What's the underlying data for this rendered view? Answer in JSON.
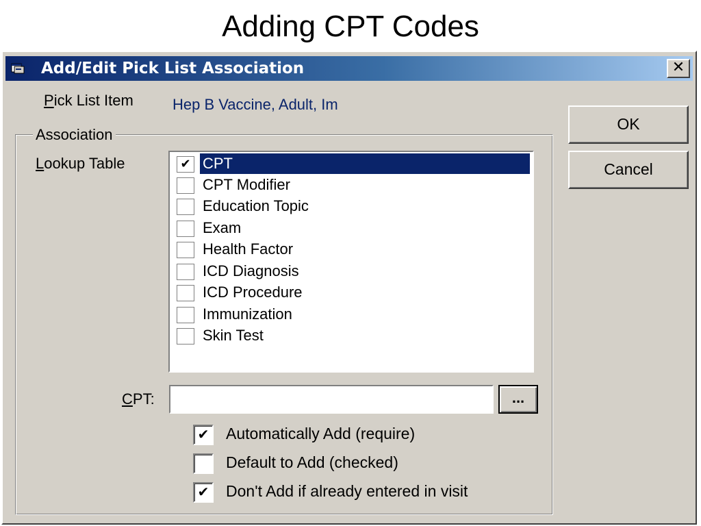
{
  "slide": {
    "title": "Adding CPT Codes"
  },
  "window": {
    "title": "Add/Edit Pick List Association",
    "icon": "window-app-icon",
    "close_label": "✕"
  },
  "pick_list": {
    "label_accel": "P",
    "label_rest": "ick List Item",
    "value": "Hep B Vaccine, Adult, Im"
  },
  "association": {
    "legend": "Association",
    "lookup_label_accel": "L",
    "lookup_label_rest": "ookup Table",
    "lookup_items": [
      {
        "label": "CPT",
        "checked": true,
        "selected": true
      },
      {
        "label": "CPT Modifier",
        "checked": false,
        "selected": false
      },
      {
        "label": "Education Topic",
        "checked": false,
        "selected": false
      },
      {
        "label": "Exam",
        "checked": false,
        "selected": false
      },
      {
        "label": "Health Factor",
        "checked": false,
        "selected": false
      },
      {
        "label": "ICD Diagnosis",
        "checked": false,
        "selected": false
      },
      {
        "label": "ICD Procedure",
        "checked": false,
        "selected": false
      },
      {
        "label": "Immunization",
        "checked": false,
        "selected": false
      },
      {
        "label": "Skin Test",
        "checked": false,
        "selected": false
      }
    ],
    "cpt_label_accel": "C",
    "cpt_label_rest": "PT:",
    "cpt_value": "",
    "cpt_placeholder": "",
    "browse_label": "...",
    "options": [
      {
        "label": "Automatically Add (require)",
        "checked": true
      },
      {
        "label": "Default to Add (checked)",
        "checked": false
      },
      {
        "label": "Don't Add if already entered in visit",
        "checked": true
      }
    ]
  },
  "buttons": {
    "ok_label": "OK",
    "cancel_label": "Cancel"
  },
  "colors": {
    "titlebar_start": "#0a246a",
    "titlebar_end": "#a6caf0",
    "dialog_face": "#d4d0c8",
    "selection": "#0a246a",
    "value_text": "#0a246a"
  }
}
